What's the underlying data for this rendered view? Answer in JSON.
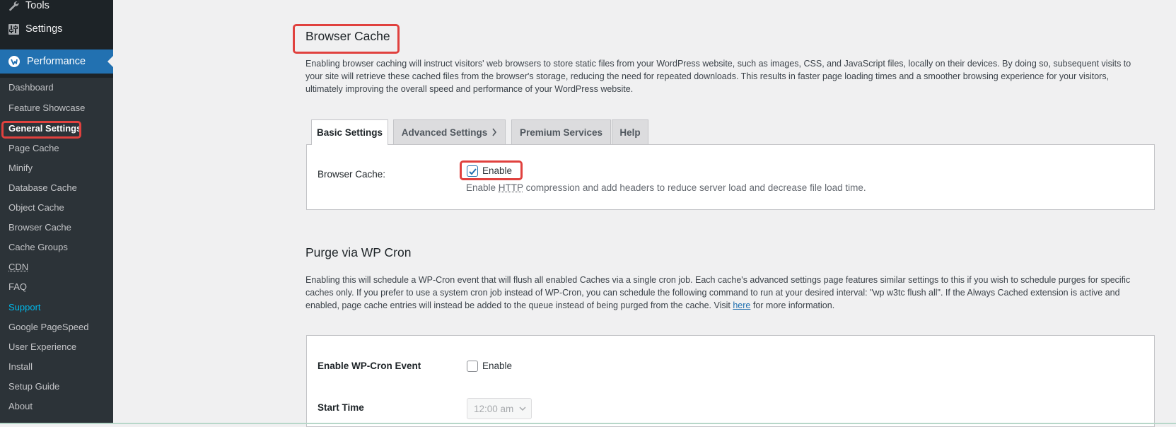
{
  "sidebar": {
    "top_items": [
      {
        "label": "Tools",
        "icon": "wrench-icon"
      },
      {
        "label": "Settings",
        "icon": "settings-sliders-icon"
      }
    ],
    "active_menu": {
      "label": "Performance",
      "icon": "w3tc-logo-icon"
    },
    "submenu": [
      {
        "label": "Dashboard"
      },
      {
        "label": "Feature Showcase"
      },
      {
        "label": "General Settings",
        "current": true
      },
      {
        "label": "Page Cache"
      },
      {
        "label": "Minify"
      },
      {
        "label": "Database Cache"
      },
      {
        "label": "Object Cache"
      },
      {
        "label": "Browser Cache"
      },
      {
        "label": "Cache Groups"
      },
      {
        "label": "CDN"
      },
      {
        "label": "FAQ"
      },
      {
        "label": "Support"
      },
      {
        "label": "Google PageSpeed"
      },
      {
        "label": "User Experience"
      },
      {
        "label": "Install"
      },
      {
        "label": "Setup Guide"
      },
      {
        "label": "About"
      }
    ]
  },
  "browser_cache_section": {
    "title": "Browser Cache",
    "description": [
      "Enabling browser caching will instruct visitors' web browsers to store static files from your WordPress website, such as images, CSS, and JavaScript files, locally on their devices. By doing so, subsequent visits to",
      "your site will retrieve these cached files from the browser's storage, reducing the need for repeated downloads. This results in faster page loading times and a smoother browsing experience for your visitors,",
      "ultimately improving the overall speed and performance of your WordPress website."
    ],
    "tabs": [
      {
        "label": "Basic Settings",
        "active": true
      },
      {
        "label": "Advanced Settings",
        "has_chevron": true
      },
      {
        "label": "Premium Services"
      },
      {
        "label": "Help"
      }
    ],
    "field": {
      "label": "Browser Cache:",
      "checkbox_label": "Enable",
      "checked": true,
      "desc_before": "Enable ",
      "desc_abbr": "HTTP",
      "desc_after": " compression and add headers to reduce server load and decrease file load time."
    }
  },
  "purge_section": {
    "title": "Purge via WP Cron",
    "description": [
      "Enabling this will schedule a WP-Cron event that will flush all enabled Caches via a single cron job. Each cache's advanced settings page features similar settings to this if you wish to schedule purges for specific",
      "caches only. If you prefer to use a system cron job instead of WP-Cron, you can schedule the following command to run at your desired interval: \"wp w3tc flush all\". If the Always Cached extension is active and",
      "enabled, page cache entries will instead be added to the queue instead of being purged from the cache. Visit "
    ],
    "link_text": "here",
    "link_after": " for more information.",
    "cron_field": {
      "label": "Enable WP-Cron Event",
      "checkbox_label": "Enable",
      "checked": false
    },
    "start_time": {
      "label": "Start Time",
      "value": "12:00 am"
    }
  }
}
